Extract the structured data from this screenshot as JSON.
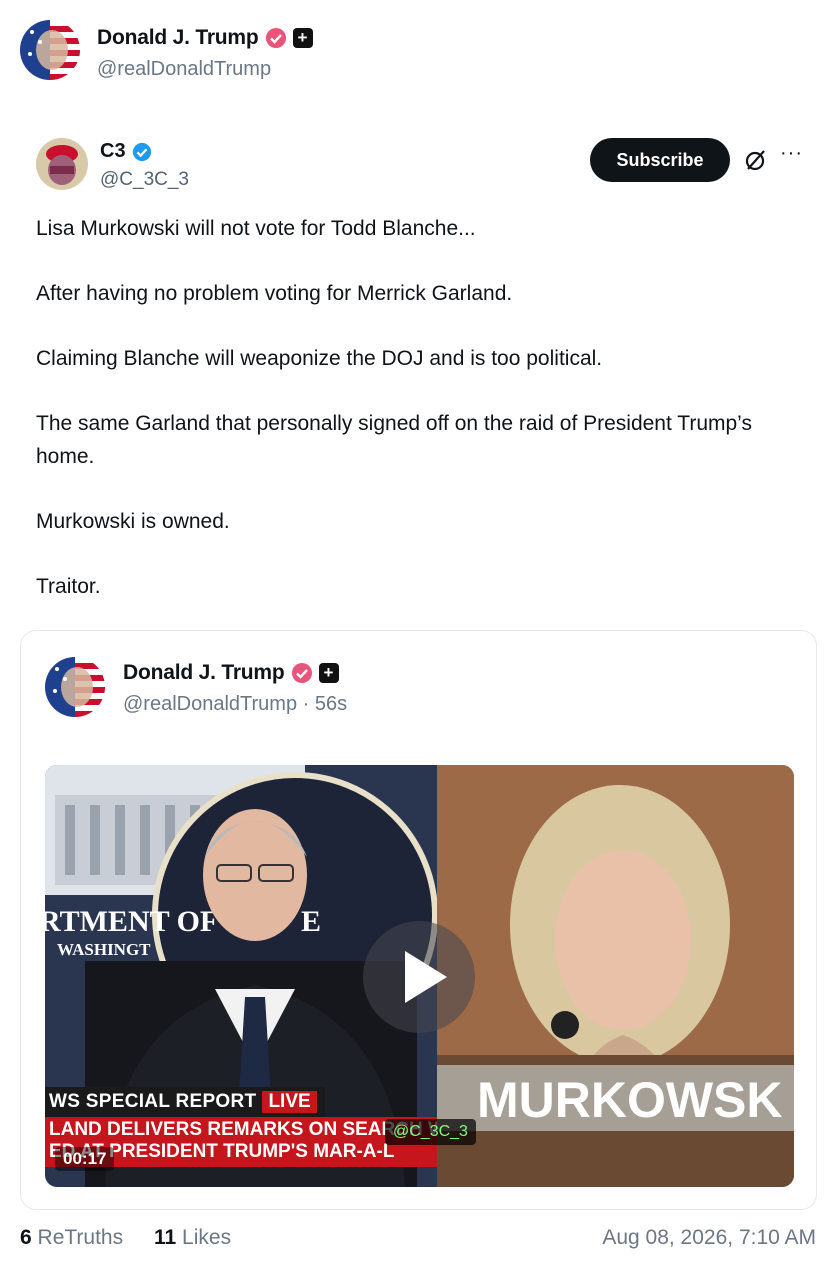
{
  "retruth": {
    "display_name": "Donald J. Trump",
    "handle": "@realDonaldTrump"
  },
  "post": {
    "display_name": "C3",
    "handle": "@C_3C_3",
    "subscribe_label": "Subscribe",
    "more_label": "···",
    "paragraphs": [
      "Lisa Murkowski will not vote for Todd Blanche...",
      "After having no problem voting for Merrick Garland.",
      "Claiming Blanche will weaponize the DOJ and is too political.",
      "The same Garland that personally signed off on the raid of President Trump’s home.",
      "Murkowski is owned.",
      "Traitor."
    ]
  },
  "quote": {
    "display_name": "Donald J. Trump",
    "handle_time": "@realDonaldTrump · 56s",
    "video": {
      "banner_special": "WS  SPECIAL REPORT",
      "banner_live": "LIVE",
      "banner_headline_1": "LAND DELIVERS REMARKS ON SEARCH W",
      "banner_headline_2": "ED AT PRESIDENT TRUMP'S MAR-A-L",
      "podium_text": "MURKOWSK",
      "seal_text_1": "RTMENT OF",
      "seal_text_2": "E",
      "seal_text_3": "WASHINGT",
      "timestamp": "00:17",
      "watermark": "@C_3C_3"
    }
  },
  "footer": {
    "retruths_count": "6",
    "retruths_label": "ReTruths",
    "likes_count": "11",
    "likes_label": "Likes",
    "date": "Aug 08, 2026, 7:10 AM"
  },
  "colors": {
    "verified_pink": "#e8547a",
    "verified_blue": "#1d9bf0",
    "live_red": "#c4161c",
    "watermark_green": "#7cff7c"
  }
}
